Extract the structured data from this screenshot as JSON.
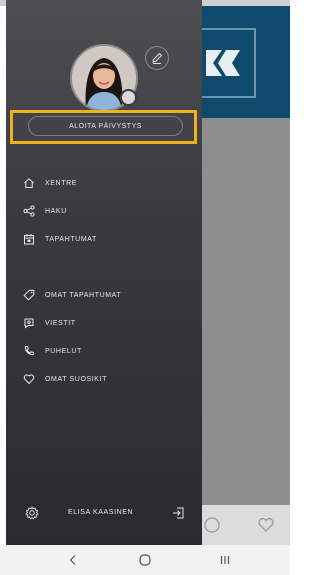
{
  "drawer": {
    "start_shift_label": "ALOITA PÄIVYSTYS",
    "menu_items": [
      {
        "label": "XENTRE",
        "icon": "home-icon"
      },
      {
        "label": "HAKU",
        "icon": "share-icon"
      },
      {
        "label": "TAPAHTUMAT",
        "icon": "calendar-icon"
      },
      {
        "label": "OMAT TAPAHTUMAT",
        "icon": "tag-icon"
      },
      {
        "label": "VIESTIT",
        "icon": "message-icon"
      },
      {
        "label": "PUHELUT",
        "icon": "phone-icon"
      },
      {
        "label": "OMAT SUOSIKIT",
        "icon": "heart-icon"
      }
    ],
    "footer": {
      "user_name": "ELISA KAASINEN",
      "settings_icon": "gear-icon",
      "logout_icon": "logout-icon"
    }
  },
  "colors": {
    "highlight": "#f0b21c",
    "drawer_bg": "#3a3a3e",
    "header_bg": "#0e4a6b"
  }
}
